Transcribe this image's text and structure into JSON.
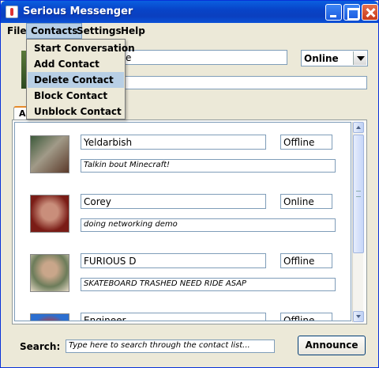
{
  "window": {
    "title": "Serious Messenger"
  },
  "menubar": {
    "items": [
      "File",
      "Contacts",
      "Settings",
      "Help"
    ]
  },
  "contacts_menu": {
    "items": [
      "Start Conversation",
      "Add Contact",
      "Delete Contact",
      "Block Contact",
      "Unblock Contact"
    ],
    "highlighted": "Delete Contact"
  },
  "profile": {
    "name_fragment": "e",
    "status": "Online",
    "message": ""
  },
  "tab": {
    "label": "A"
  },
  "contacts": [
    {
      "name": "Yeldarbish",
      "status": "Offline",
      "message": "Talkin bout Minecraft!"
    },
    {
      "name": "Corey",
      "status": "Online",
      "message": "doing networking demo"
    },
    {
      "name": "FURIOUS D",
      "status": "Offline",
      "message": "SKATEBOARD TRASHED NEED RIDE ASAP"
    },
    {
      "name": "Engineer",
      "status": "Offline",
      "message": ""
    }
  ],
  "search": {
    "label": "Search:",
    "placeholder": "Type here to search through the contact list..."
  },
  "announce_button": {
    "label": "Announce"
  },
  "colors": {
    "titlebar": "#0a4ed0",
    "menu_highlight": "#b8cfe5",
    "window_bg": "#ece9d8"
  }
}
